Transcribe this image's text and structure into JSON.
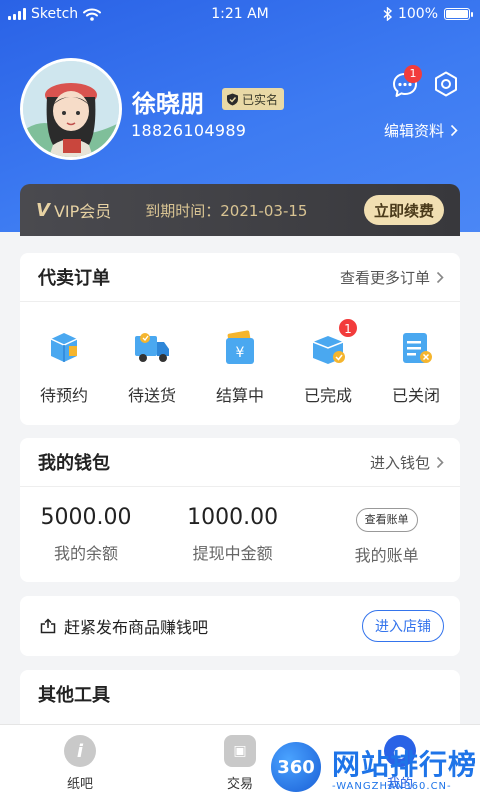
{
  "status_bar": {
    "carrier": "Sketch",
    "time": "1:21 AM",
    "battery": "100%"
  },
  "profile": {
    "name": "徐晓朋",
    "verified_label": "已实名",
    "phone": "18826104989",
    "message_badge": "1",
    "edit_label": "编辑资料"
  },
  "vip": {
    "badge_text": "VIP会员",
    "icon_text": "V",
    "expire_text": "到期时间：2021-03-15",
    "renew_label": "立即续费"
  },
  "orders": {
    "title": "代卖订单",
    "more_label": "查看更多订单",
    "items": [
      {
        "label": "待预约",
        "icon": "box-icon"
      },
      {
        "label": "待送货",
        "icon": "truck-icon"
      },
      {
        "label": "结算中",
        "icon": "wallet-yen-icon"
      },
      {
        "label": "已完成",
        "icon": "box-check-icon",
        "badge": "1"
      },
      {
        "label": "已关闭",
        "icon": "clipboard-closed-icon"
      }
    ]
  },
  "wallet": {
    "title": "我的钱包",
    "enter_label": "进入钱包",
    "balance_amount": "5000.00",
    "balance_label": "我的余额",
    "withdraw_amount": "1000.00",
    "withdraw_label": "提现中金额",
    "bill_chip": "查看账单",
    "bill_label": "我的账单"
  },
  "promo": {
    "text": "赶紧发布商品赚钱吧",
    "button": "进入店铺"
  },
  "tools": {
    "title": "其他工具"
  },
  "tabbar": {
    "tabs": [
      {
        "label": "纸吧",
        "icon": "info-icon"
      },
      {
        "label": "交易",
        "icon": "wallet-icon"
      },
      {
        "label": "我的",
        "icon": "user-icon",
        "active": true
      }
    ]
  },
  "watermark": {
    "logo": "360",
    "title": "网站排行榜",
    "subtitle": "-WANGZHAN360.CN-"
  },
  "colors": {
    "primary": "#2a62e6",
    "vip_gold": "#e7d2a3",
    "badge_red": "#f23c3c"
  }
}
